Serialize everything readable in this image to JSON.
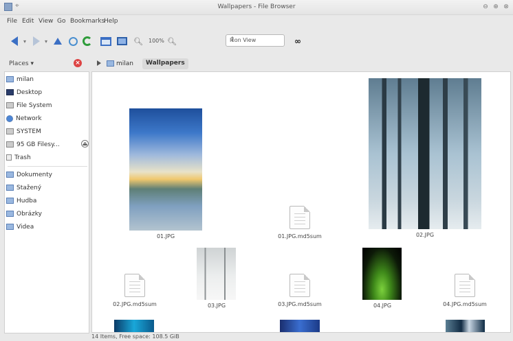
{
  "window": {
    "title": "Wallpapers - File Browser"
  },
  "menubar": {
    "items": [
      "File",
      "Edit",
      "View",
      "Go",
      "Bookmarks",
      "Help"
    ]
  },
  "toolbar": {
    "zoom_level": "100%",
    "view_mode": "Icon View"
  },
  "places": {
    "header": "Places",
    "items": [
      {
        "label": "milan",
        "icon": "home-folder-icon"
      },
      {
        "label": "Desktop",
        "icon": "desktop-icon"
      },
      {
        "label": "File System",
        "icon": "drive-icon"
      },
      {
        "label": "Network",
        "icon": "network-icon"
      },
      {
        "label": "SYSTEM",
        "icon": "drive-icon"
      },
      {
        "label": "95 GB Filesy...",
        "icon": "drive-icon"
      },
      {
        "label": "Trash",
        "icon": "trash-icon"
      },
      {
        "label": "Dokumenty",
        "icon": "folder-icon"
      },
      {
        "label": "Stažený",
        "icon": "folder-icon"
      },
      {
        "label": "Hudba",
        "icon": "folder-icon"
      },
      {
        "label": "Obrázky",
        "icon": "folder-icon"
      },
      {
        "label": "Videa",
        "icon": "folder-icon"
      }
    ]
  },
  "breadcrumb": {
    "home": "milan",
    "current": "Wallpapers"
  },
  "files": [
    {
      "name": "01.JPG",
      "kind": "image"
    },
    {
      "name": "01.JPG.md5sum",
      "kind": "document"
    },
    {
      "name": "02.JPG",
      "kind": "image"
    },
    {
      "name": "02.JPG.md5sum",
      "kind": "document"
    },
    {
      "name": "03.JPG",
      "kind": "image"
    },
    {
      "name": "03.JPG.md5sum",
      "kind": "document"
    },
    {
      "name": "04.JPG",
      "kind": "image"
    },
    {
      "name": "04.JPG.md5sum",
      "kind": "document"
    }
  ],
  "status": {
    "text": "14 Items, Free space: 108.5 GiB"
  }
}
